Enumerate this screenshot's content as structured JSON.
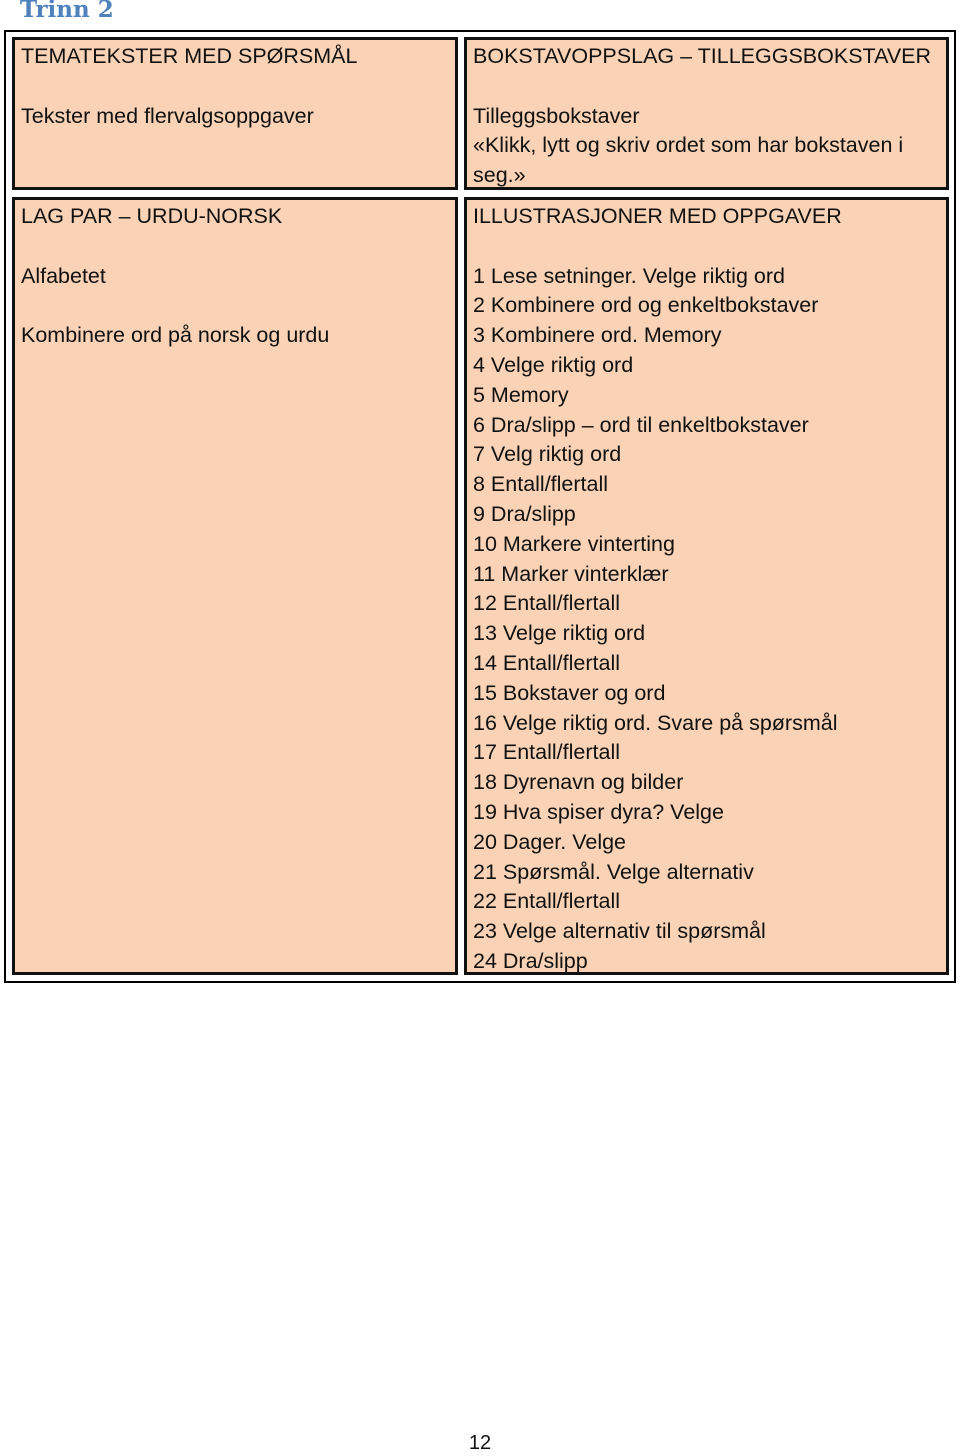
{
  "page_title": "Trinn 2",
  "cells": {
    "temaktekster": {
      "heading": "TEMATEKSTER MED SPØRSMÅL",
      "items": [
        "Tekster med flervalgsoppgaver"
      ]
    },
    "bokstavoppslag": {
      "heading": "BOKSTAVOPPSLAG – TILLEGGSBOKSTAVER",
      "items": [
        "Tilleggsbokstaver",
        "«Klikk, lytt og skriv ordet som har bokstaven i",
        "seg.»"
      ]
    },
    "lag_par": {
      "heading": "LAG PAR – URDU-NORSK",
      "items": [
        "Alfabetet",
        "",
        "Kombinere ord på norsk og urdu"
      ]
    },
    "illustrasjoner": {
      "heading": "ILLUSTRASJONER MED OPPGAVER",
      "items": [
        "1 Lese setninger. Velge riktig ord",
        "2 Kombinere ord og enkeltbokstaver",
        "3 Kombinere ord. Memory",
        "4 Velge riktig ord",
        "5 Memory",
        "6 Dra/slipp – ord til enkeltbokstaver",
        "7 Velg riktig ord",
        "8 Entall/flertall",
        "9 Dra/slipp",
        "10 Markere vinterting",
        "11 Marker vinterklær",
        "12 Entall/flertall",
        "13 Velge riktig ord",
        "14 Entall/flertall",
        "15 Bokstaver og ord",
        "16 Velge riktig ord. Svare på spørsmål",
        "17 Entall/flertall",
        "18 Dyrenavn og bilder",
        "19 Hva spiser dyra? Velge",
        "20 Dager. Velge",
        "21 Spørsmål. Velge alternativ",
        "22 Entall/flertall",
        "23 Velge alternativ til spørsmål",
        "24 Dra/slipp"
      ]
    }
  },
  "page_number": "12",
  "colors": {
    "cell_fill": "#fad3b6",
    "title": "#4f81bd"
  }
}
